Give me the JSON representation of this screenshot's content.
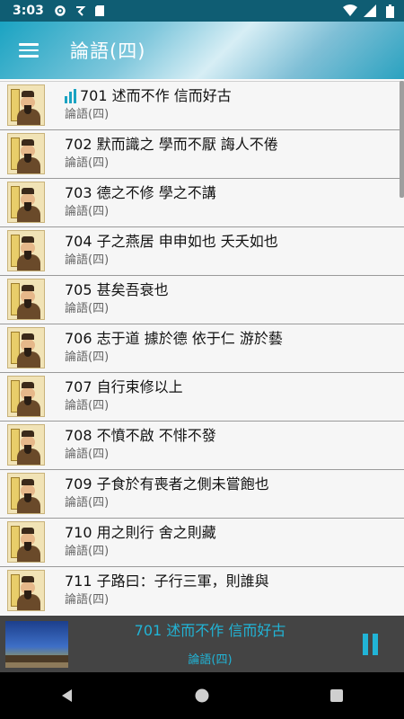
{
  "status_bar": {
    "time": "3:03",
    "icons": [
      "settings-icon",
      "notification-icon",
      "sd-card-icon",
      "wifi-icon",
      "signal-icon",
      "battery-icon"
    ]
  },
  "app_bar": {
    "title": "論語(四)",
    "menu_icon": "hamburger-menu-icon"
  },
  "tracks": [
    {
      "title": "701 述而不作 信而好古",
      "subtitle": "論語(四)",
      "playing": true
    },
    {
      "title": "702 默而識之 學而不厭 誨人不倦",
      "subtitle": "論語(四)"
    },
    {
      "title": "703 德之不修 學之不講",
      "subtitle": "論語(四)"
    },
    {
      "title": "704 子之燕居 申申如也 夭夭如也",
      "subtitle": "論語(四)"
    },
    {
      "title": "705 甚矣吾衰也",
      "subtitle": "論語(四)"
    },
    {
      "title": "706 志于道 據於德 依于仁 游於藝",
      "subtitle": "論語(四)"
    },
    {
      "title": "707 自行束修以上",
      "subtitle": "論語(四)"
    },
    {
      "title": "708 不憤不啟 不悱不發",
      "subtitle": "論語(四)"
    },
    {
      "title": "709 子食於有喪者之側未嘗飽也",
      "subtitle": "論語(四)"
    },
    {
      "title": "710 用之則行 舍之則藏",
      "subtitle": "論語(四)"
    },
    {
      "title": "711 子路曰：子行三軍，則誰與",
      "subtitle": "論語(四)"
    }
  ],
  "player": {
    "title": "701 述而不作 信而好古",
    "subtitle": "論語(四)",
    "state_icon": "pause-icon"
  },
  "nav_bar": {
    "icons": [
      "back-icon",
      "home-icon",
      "recents-icon"
    ]
  },
  "colors": {
    "status_bar": "#0f5d73",
    "accent": "#21b4d6",
    "player_bg": "#444444"
  }
}
